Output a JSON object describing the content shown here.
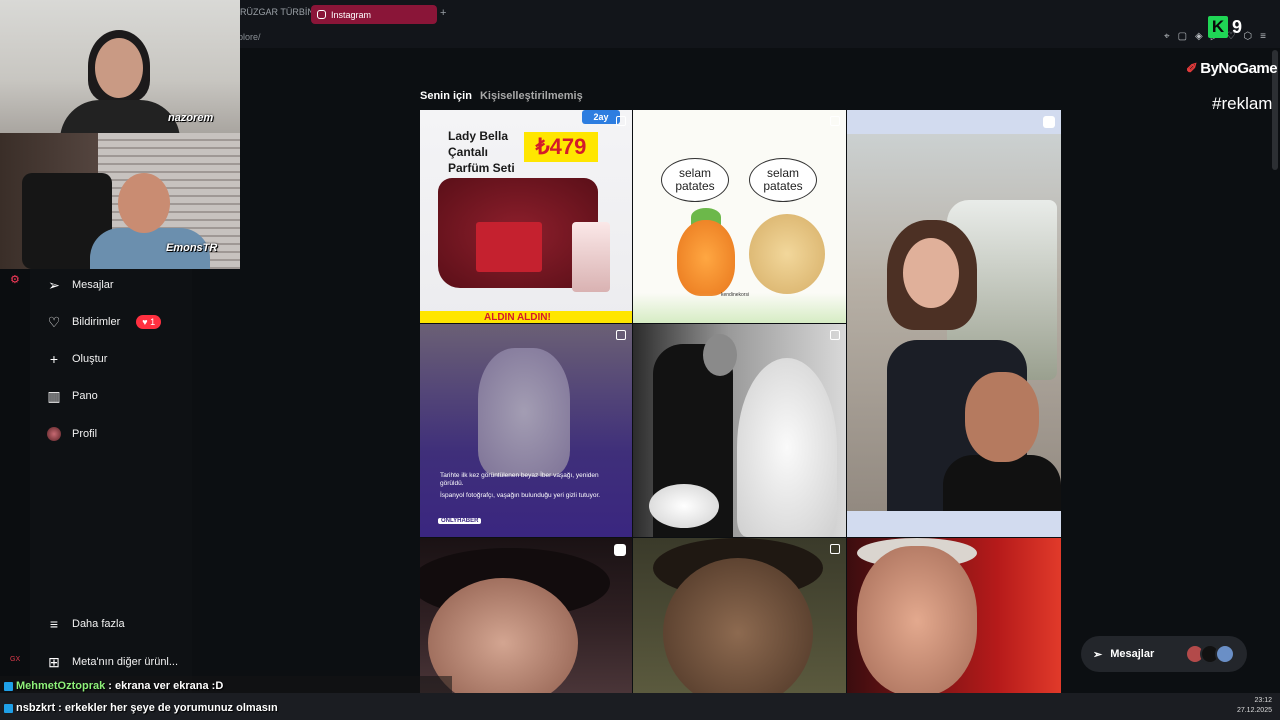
{
  "browser": {
    "prev_tab": "RÜZGAR TÜRBİN",
    "active_tab": "Instagram",
    "new_tab": "+",
    "url": "plore/"
  },
  "overlays": {
    "cam1_name": "nazorem",
    "cam2_name": "EmonsTR",
    "k_logo": "K",
    "k_number": "9",
    "brand": "ByNoGame",
    "hashtag": "#reklam"
  },
  "sidebar": {
    "items": [
      {
        "label": "Mesajlar",
        "icon": "send-icon"
      },
      {
        "label": "Bildirimler",
        "icon": "heart-icon",
        "badge": "1"
      },
      {
        "label": "Oluştur",
        "icon": "plus-icon"
      },
      {
        "label": "Pano",
        "icon": "dashboard-icon"
      },
      {
        "label": "Profil",
        "icon": "avatar"
      }
    ],
    "more": "Daha fazla",
    "meta": "Meta'nın diğer ürünl...",
    "gx": "GX"
  },
  "feed": {
    "tab_active": "Senin için",
    "tab_inactive": "Kişiselleştirilmemiş",
    "post1": {
      "title": "Lady Bella Çantalı Parfüm Seti",
      "price": "₺479",
      "tag": "2ay",
      "strip": "ALDIN ALDIN!"
    },
    "post2": {
      "bubble_left": "selam patates",
      "bubble_right": "selam patates",
      "signature": "kendinekorsi"
    },
    "post4": {
      "text": "Tarihte ilk kez görüntülenen beyaz İber vaşağı, yeniden görüldü.",
      "text2": "İspanyol fotoğrafçı, vaşağın bulunduğu yeri gizli tutuyor.",
      "source": "ONLYHABER"
    }
  },
  "messages_pill": {
    "label": "Mesajlar"
  },
  "chat": [
    {
      "user": "MehmetOztoprak",
      "message": "ekrana ver ekrana :D"
    },
    {
      "user": "nsbzkrt",
      "message": "erkekler her şeye de yorumunuz olmasın"
    }
  ],
  "taskbar": {
    "time": "23:12",
    "date": "27.12.2025"
  },
  "colors": {
    "accent_tab": "#8a1538",
    "badge": "#ff3040",
    "k_green": "#1fd655"
  }
}
